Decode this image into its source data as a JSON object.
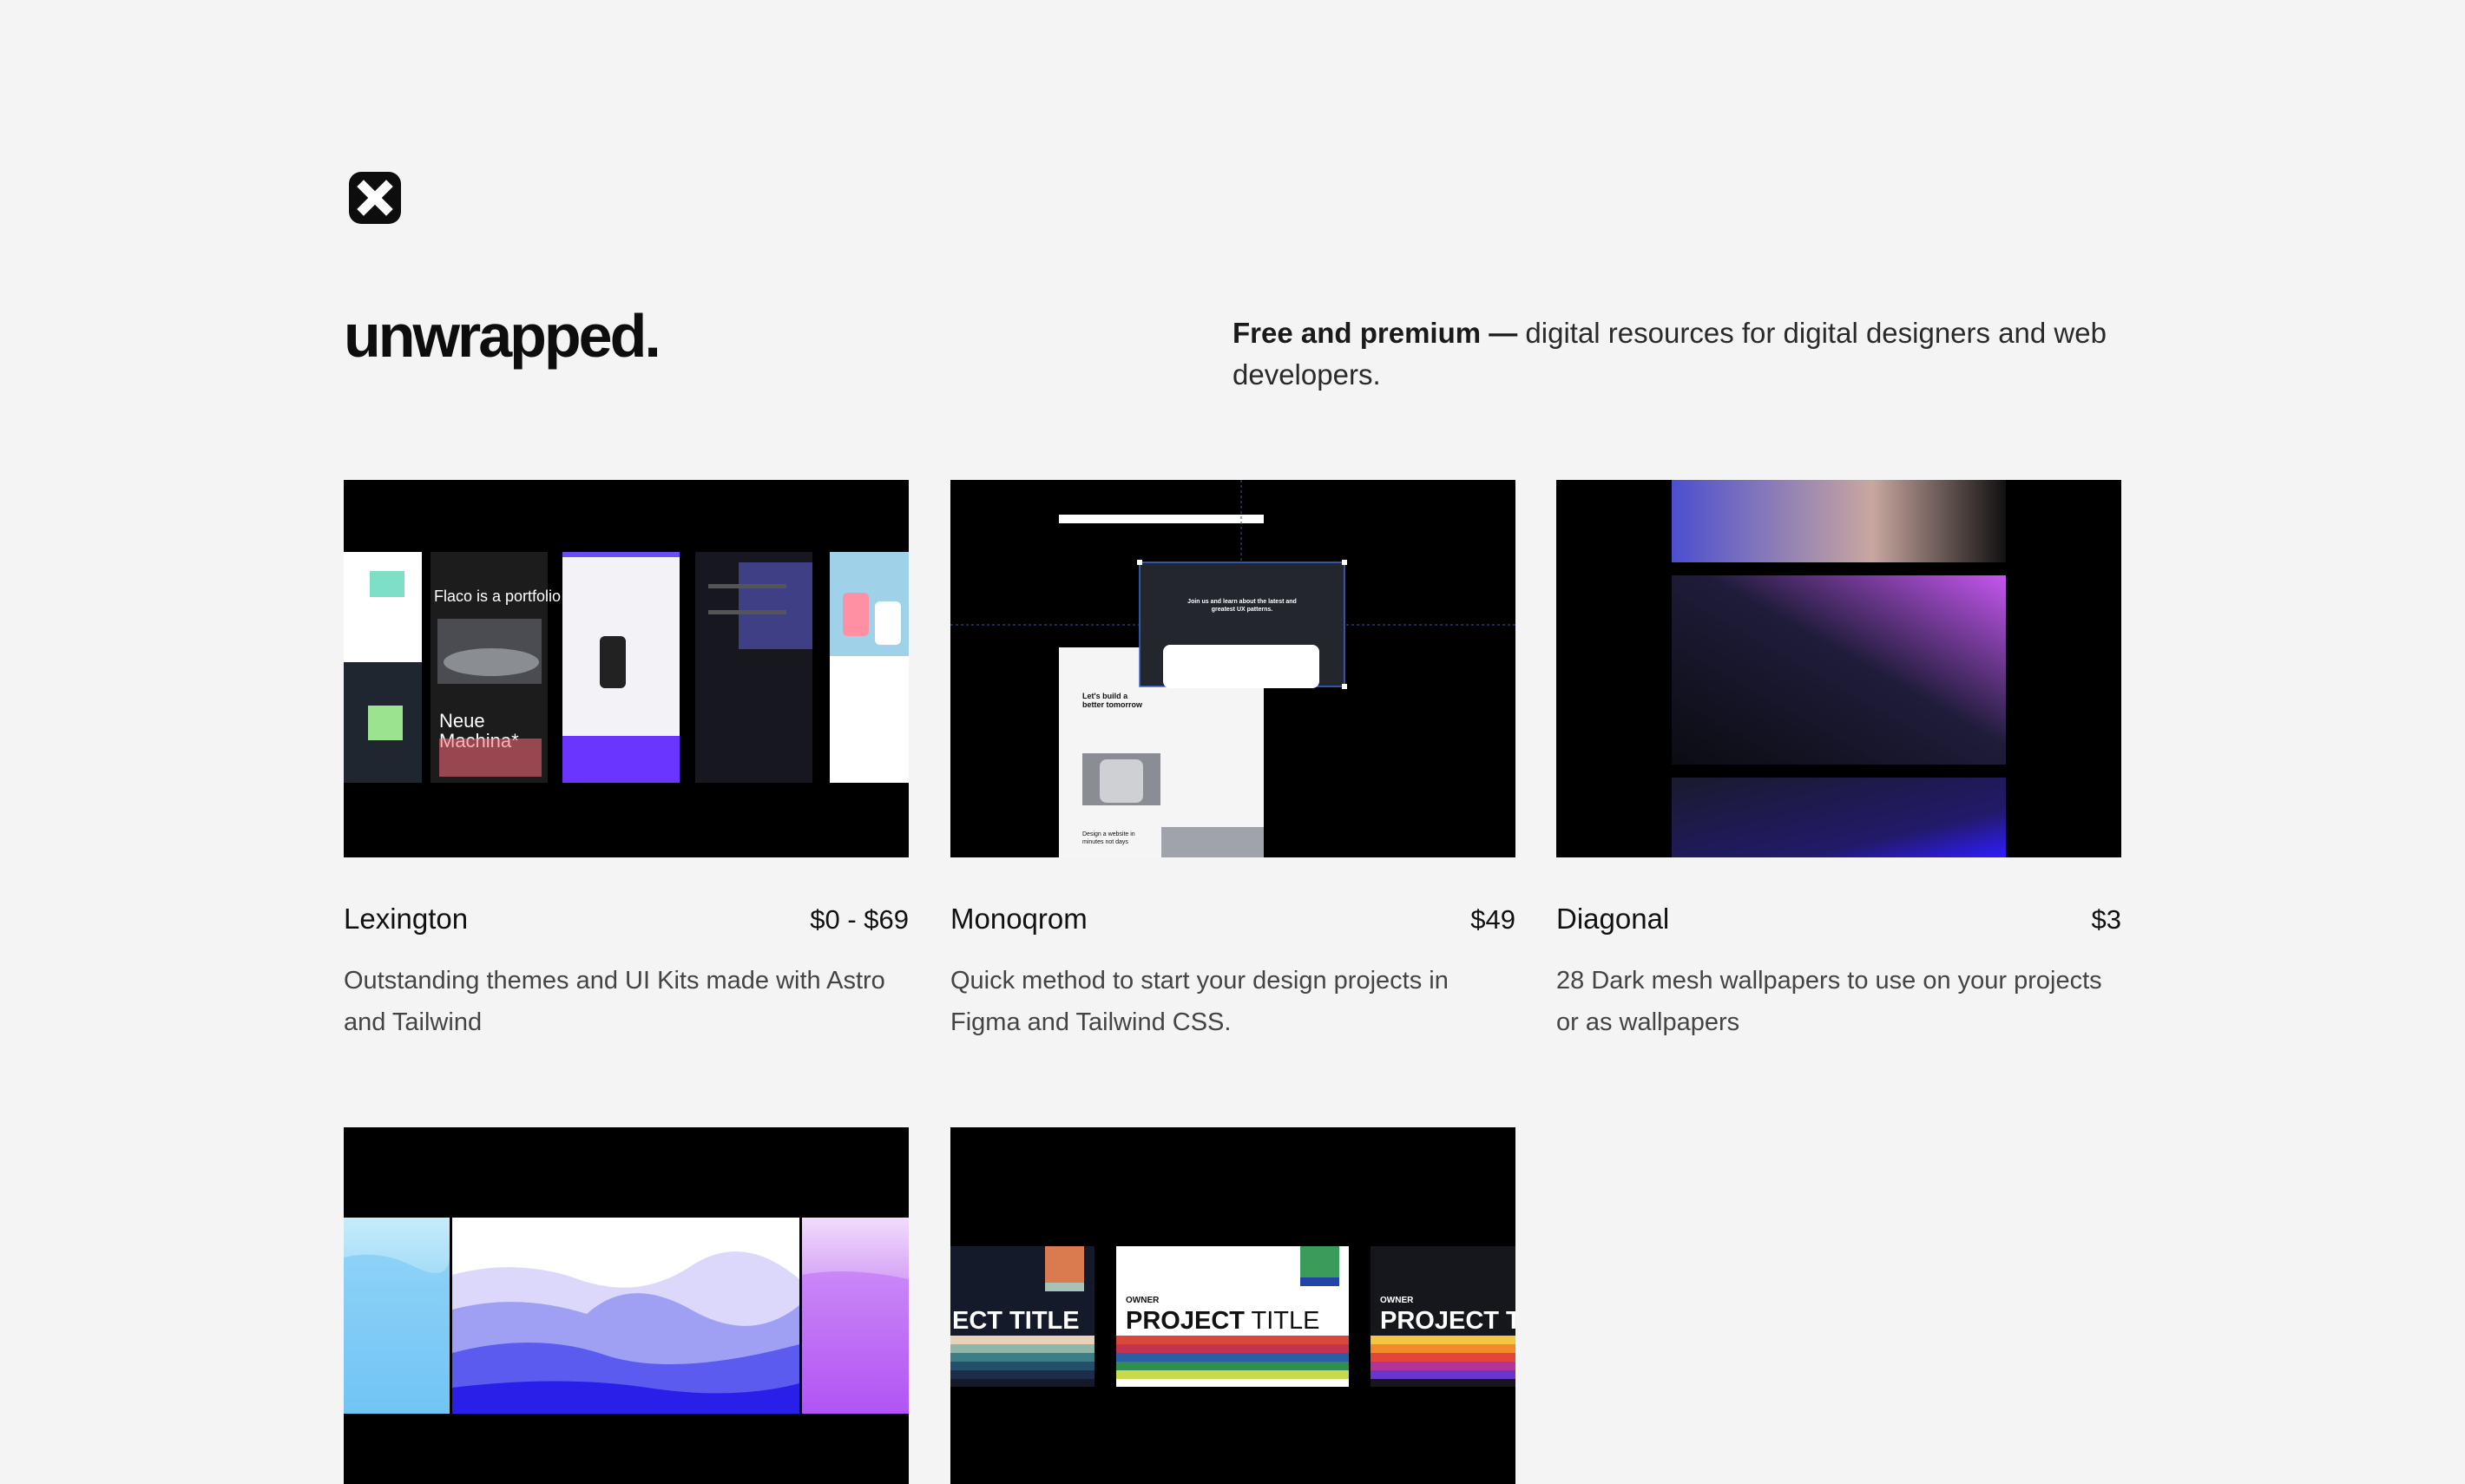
{
  "logo": {
    "icon": "close-x-square-icon"
  },
  "brand": {
    "title": "unwrapped."
  },
  "tagline": {
    "bold": "Free and premium —",
    "text": " digital resources for digital designers and web developers."
  },
  "products": [
    {
      "name": "Lexington",
      "price": "$0 - $69",
      "description": "Outstanding themes and UI Kits made with Astro and Tailwind",
      "preview_text_1": "Flaco is a portfolio",
      "preview_text_2": "Neue Machina*"
    },
    {
      "name": "Monoqrom",
      "price": "$49",
      "description": "Quick method to start your design projects in Figma and Tailwind CSS.",
      "preview_text_1": "Join us and learn about the latest and greatest UX patterns.",
      "preview_text_2": "Let's build a better tomorrow",
      "preview_text_3": "Design a website in minutes not days"
    },
    {
      "name": "Diagonal",
      "price": "$3",
      "description": "28 Dark mesh wallpapers to use on your projects or as wallpapers"
    },
    {
      "name": "",
      "price": "",
      "description": ""
    },
    {
      "name": "",
      "price": "",
      "description": "",
      "preview_owner": "OWNER",
      "preview_title_bold": "PROJECT",
      "preview_title_light": " TITLE",
      "preview_title_cut": "ECT TITLE"
    }
  ]
}
